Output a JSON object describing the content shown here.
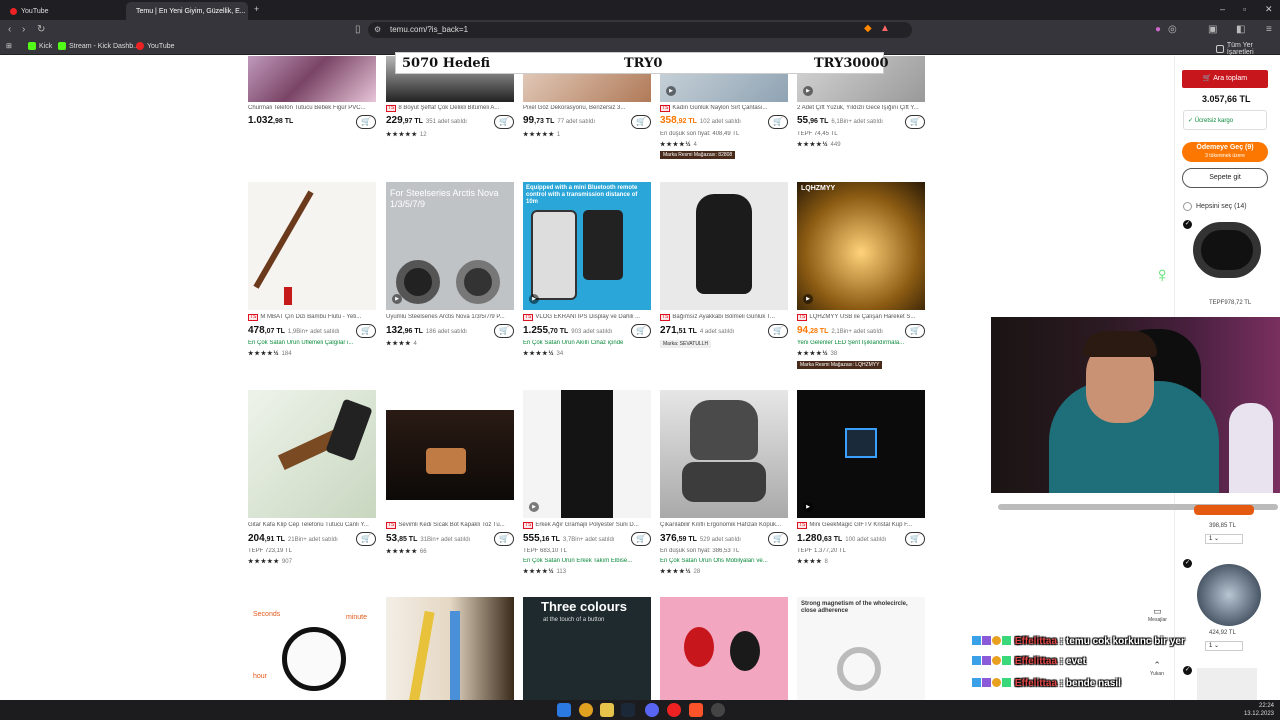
{
  "browser": {
    "tabs": [
      {
        "label": "YouTube"
      },
      {
        "label": "Temu | En Yeni Giyim, Güzellik, E..."
      }
    ],
    "url": "temu.com/?is_back=1",
    "bookmarks": [
      {
        "label": "Kick"
      },
      {
        "label": "Stream - Kick Dashb..."
      },
      {
        "label": "YouTube"
      }
    ],
    "all_bookmarks": "Tüm Yer İşaretleri"
  },
  "overlay": {
    "goal_label": "5070  Hedefi",
    "current": "TRY0",
    "target": "TRY30000"
  },
  "products": [
    {
      "title": "Churmali Telefon Tutucu Bebek Figür PVC...",
      "price_main": "1.032",
      "price_dec": ",98 TL",
      "sold": "",
      "sub": "",
      "stars": "",
      "count": "",
      "tag": ""
    },
    {
      "title": "8 Boyut Şeffaf Çok Delikli Bitümeli A...",
      "price_main": "229",
      "price_dec": ",97 TL",
      "sold": "351 adet satıldı",
      "sub": "",
      "stars": "★★★★★",
      "count": "12",
      "tag": "yes"
    },
    {
      "title": "Pixel Göz Dekorasyonu, Benzersiz 3...",
      "price_main": "99",
      "price_dec": ",73 TL",
      "sold": "77 adet satıldı",
      "sub": "",
      "stars": "★★★★★",
      "count": "1",
      "tag": ""
    },
    {
      "title": "Kadın Günlük Naylon Sırt Çantası...",
      "price_main": "358",
      "price_dec": ",92 TL",
      "sold": "102 adet satıldı",
      "sub": "En düşük son fiyat: 408,49 TL",
      "stars": "★★★★½",
      "count": "4",
      "tag": "yes",
      "badge": "Marka Resmi Mağazası: 82808"
    },
    {
      "title": "2 Adet Çift Yüzük, Yıldızlı Gece İşığını Çift Y...",
      "price_main": "55",
      "price_dec": ",96 TL",
      "sold": "6,1Bin+ adet satıldı",
      "sub": "TEPF 74,45 TL",
      "stars": "★★★★½",
      "count": "449",
      "tag": ""
    },
    {
      "title": "M MBAT Çin Dizi Bambu Flütü - Yeti...",
      "price_main": "478",
      "price_dec": ",07 TL",
      "sold": "1,9Bin+ adet satıldı",
      "sub": "En Çok Satan Ürün Üflemeli Çalgılar i...",
      "stars": "★★★★½",
      "count": "184",
      "tag": "yes"
    },
    {
      "title": "Uyumlu Steelseries Arctis Nova 1/3/5/7/9 P...",
      "price_main": "132",
      "price_dec": ",96 TL",
      "sold": "186 adet satıldı",
      "sub": "",
      "stars": "★★★★",
      "count": "4",
      "tag": ""
    },
    {
      "title": "VLOG EKRANI IPS Display ve Dahili ...",
      "price_main": "1.255",
      "price_dec": ",70 TL",
      "sold": "903 adet satıldı",
      "sub": "En Çok Satan Ürün Akıllı Cihaz içinde",
      "stars": "★★★★½",
      "count": "34",
      "tag": "yes"
    },
    {
      "title": "Bağımsız Ayakkabı Bölmeli Günlük T...",
      "price_main": "271",
      "price_dec": ",51 TL",
      "sold": "4 adet satıldı",
      "sub": "",
      "stars": "",
      "count": "",
      "tag": "yes",
      "badge2": "Marka: SEVATULLH"
    },
    {
      "title": "LQHZMYY USB ile Çalışan Hareket S...",
      "price_main": "94",
      "price_dec": ",28 TL",
      "sold": "2,1Bin+ adet satıldı",
      "sub": "Yeni Gelenler LED Şerit Işıklandırmala...",
      "stars": "★★★★½",
      "count": "38",
      "tag": "yes",
      "badge": "Marka Resmi Mağazası: LQHZMYY"
    },
    {
      "title": "Gitar Kafa Klip Cep Telefonu Tutucu Canlı Y...",
      "price_main": "204",
      "price_dec": ",91 TL",
      "sold": "21Bin+ adet satıldı",
      "sub": "TEPF 723,19 TL",
      "stars": "★★★★★",
      "count": "907",
      "tag": ""
    },
    {
      "title": "Sevimli Kedi Sıcak Bot Kapaklı Toz Tu...",
      "price_main": "53",
      "price_dec": ",85 TL",
      "sold": "31Bin+ adet satıldı",
      "sub": "",
      "stars": "★★★★★",
      "count": "66",
      "tag": "yes"
    },
    {
      "title": "Erkek Ağır Gramajlı Polyester Suni D...",
      "price_main": "555",
      "price_dec": ",16 TL",
      "sold": "3,7Bin+ adet satıldı",
      "sub": "TEPF 683,10 TL",
      "sub2": "En Çok Satan Ürün Erkek Takım Elbise...",
      "stars": "★★★★½",
      "count": "113",
      "tag": "yes"
    },
    {
      "title": "Çıkarılabilir Kılıflı Ergonomik Hafızalı Köpük...",
      "price_main": "376",
      "price_dec": ",59 TL",
      "sold": "529 adet satıldı",
      "sub": "En düşük son fiyat: 386,53 TL",
      "sub2": "En Çok Satan Ürün Ofis Mobilyaları ve...",
      "stars": "★★★★½",
      "count": "28",
      "tag": ""
    },
    {
      "title": "Mini GeekMagic GIFTV Kristal Küp F...",
      "price_main": "1.280",
      "price_dec": ",63 TL",
      "sold": "100 adet satıldı",
      "sub": "TEPF 1.377,20 TL",
      "stars": "★★★★",
      "count": "8",
      "tag": "yes"
    }
  ],
  "row4_texts": {
    "watch_sec": "Seconds",
    "watch_min": "minute",
    "watch_hour": "hour",
    "three_colours": "Three colours",
    "three_colours_sub": "at the touch of a button",
    "magnet": "Strong magnetism of the wholecircle, close adherence"
  },
  "row2_texts": {
    "steelseries": "For Steelseries Arctis Nova 1/3/5/7/9",
    "vlog": "Equipped with a mini Bluetooth remote control with a transmission distance of 10m",
    "lqhz": "LQHZMYY"
  },
  "sidebar": {
    "subtotal_btn": "Ara toplam",
    "subtotal": "3.057,66 TL",
    "free_ship": "✓ Ücretsiz kargo",
    "checkout": "Ödemeye Geç (9)",
    "checkout_sub": "3 tükenmek üzere",
    "go_cart": "Sepete git",
    "select_all": "Hepsini seç (14)",
    "item1_price": "TEPF978,72 TL",
    "item2_price": "398,85 TL",
    "item2_qty": "1",
    "item3_price": "424,92 TL",
    "item3_qty": "1"
  },
  "floating": {
    "messages": "Mesajlar",
    "top": "Yukarı"
  },
  "chat": [
    {
      "name": "Effelittaa",
      "msg": ": temu cok korkunc bir yer"
    },
    {
      "name": "Effelittaa",
      "msg": ": evet"
    },
    {
      "name": "Effelittaa",
      "msg": ": bende nasil"
    }
  ],
  "clock": {
    "time": "22:24",
    "date": "13.12.2023"
  }
}
